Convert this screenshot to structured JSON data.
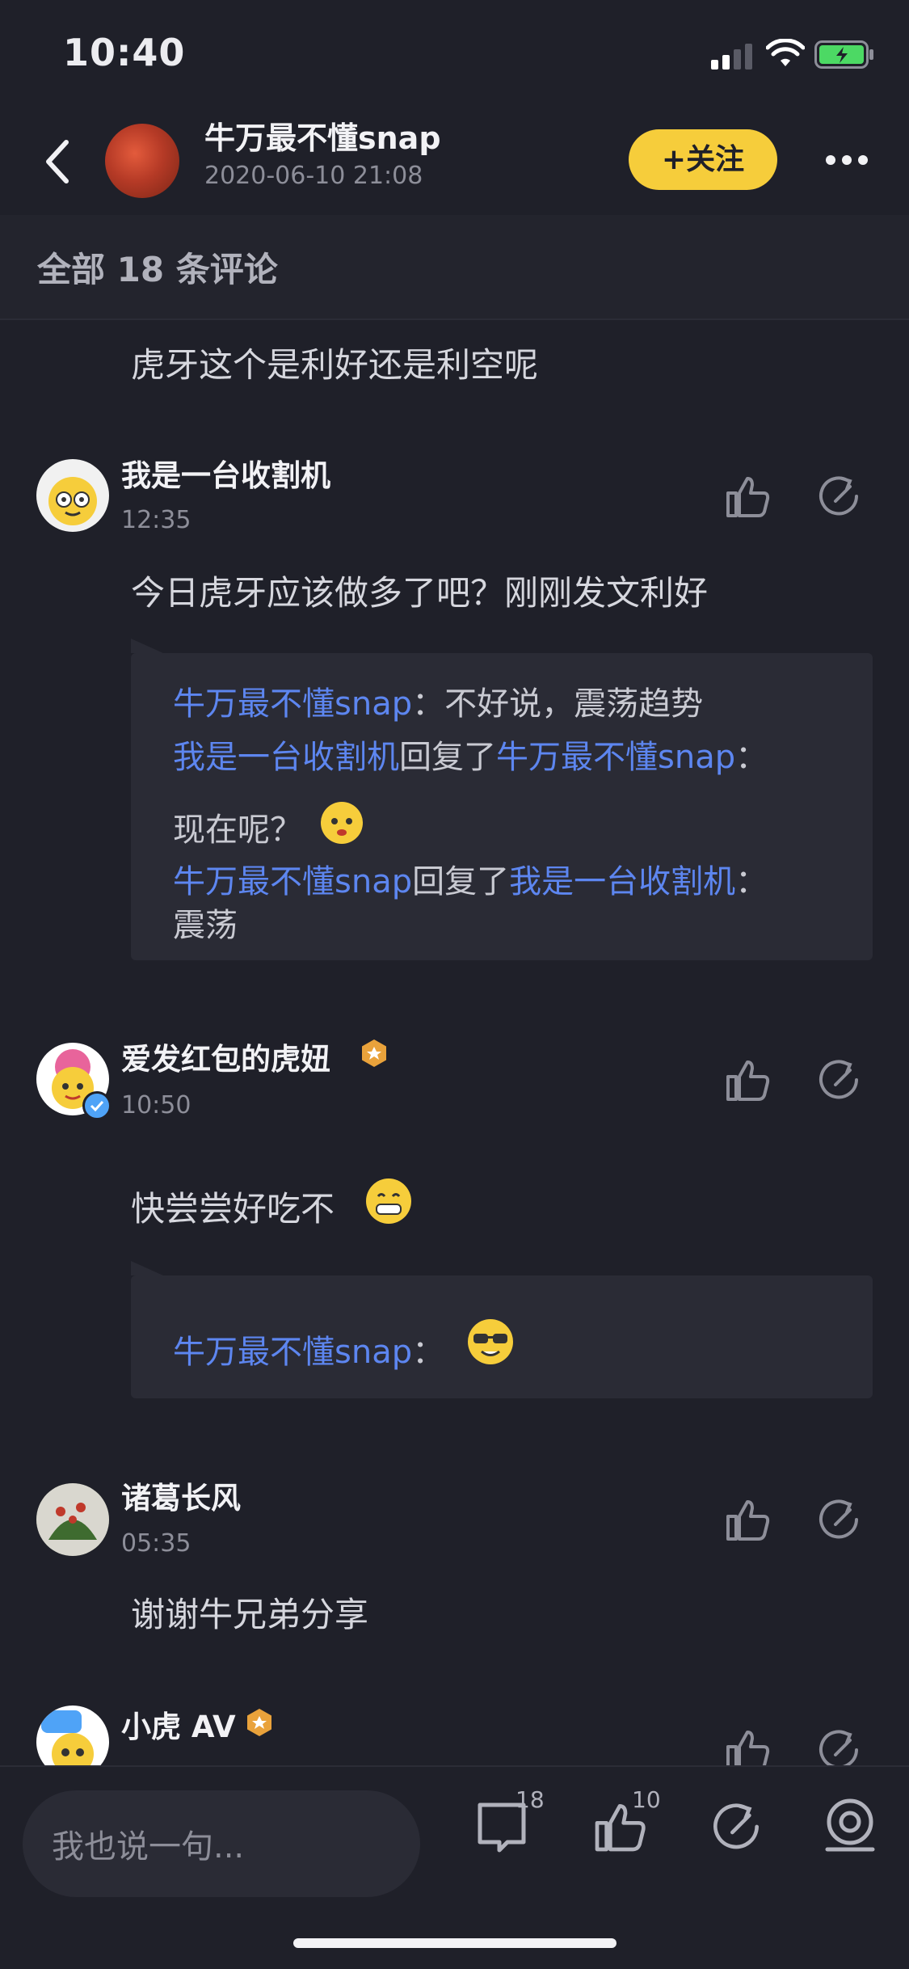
{
  "status_bar": {
    "time": "10:40"
  },
  "header": {
    "author_name": "牛万最不懂snap",
    "date": "2020-06-10 21:08",
    "follow_label": "+关注"
  },
  "comments_header": {
    "count_text": "全部 18 条评论"
  },
  "top_reply_text": "虎牙这个是利好还是利空呢",
  "comments": [
    {
      "username": "我是一台收割机",
      "time": "12:35",
      "text": "今日虎牙应该做多了吧？刚刚发文利好",
      "replies": [
        {
          "from": "牛万最不懂snap",
          "sep": "：",
          "text": "不好说，震荡趋势"
        },
        {
          "from": "我是一台收割机",
          "verb": "回复了",
          "to": "牛万最不懂snap",
          "sep": "：",
          "text": "现在呢？"
        },
        {
          "from": "牛万最不懂snap",
          "verb": "回复了",
          "to": "我是一台收割机",
          "sep": "：",
          "text": "震荡"
        }
      ]
    },
    {
      "username": "爱发红包的虎妞",
      "time": "10:50",
      "text": "快尝尝好吃不",
      "replies": [
        {
          "from": "牛万最不懂snap",
          "sep": "："
        }
      ]
    },
    {
      "username": "诸葛长风",
      "time": "05:35",
      "text": "谢谢牛兄弟分享"
    },
    {
      "username": "小虎 AV"
    }
  ],
  "bottom_bar": {
    "input_placeholder": "我也说一句...",
    "comment_count": "18",
    "like_count": "10"
  },
  "colors": {
    "background": "#1f2029",
    "accent_yellow": "#f6cd3b",
    "link_blue": "#5d86f0",
    "reply_box": "#2a2b35"
  },
  "icons": [
    "back-icon",
    "more-icon",
    "thumbs-up-icon",
    "share-icon",
    "comment-icon",
    "camera-icon",
    "signal-icon",
    "wifi-icon",
    "battery-icon"
  ]
}
